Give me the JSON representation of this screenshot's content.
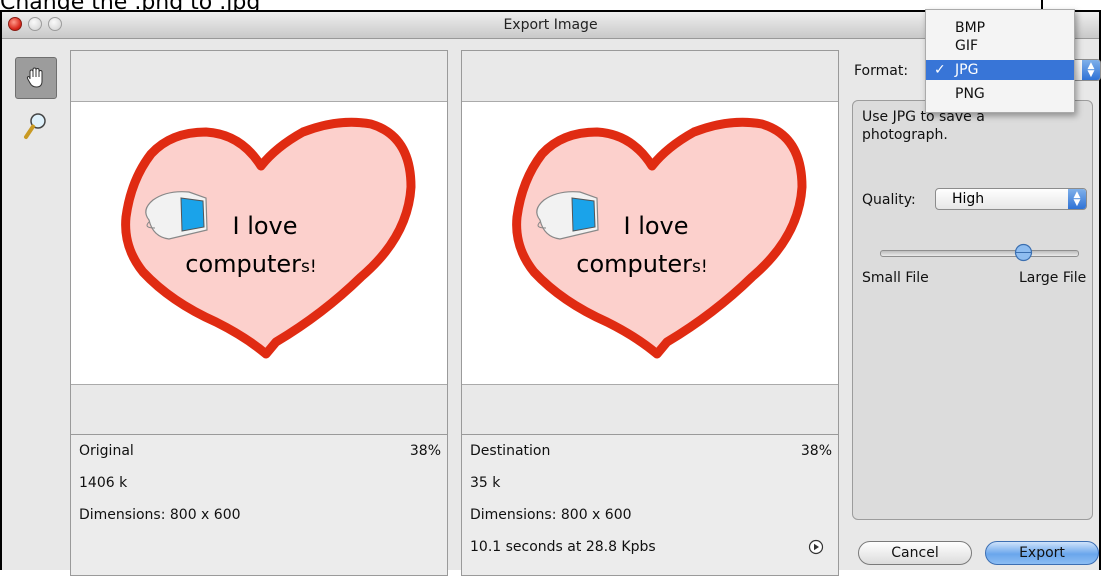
{
  "annotation": {
    "text": "Change the .png to .jpg"
  },
  "window": {
    "title": "Export Image"
  },
  "tools": [
    {
      "icon": "hand-icon"
    },
    {
      "icon": "magnifier-icon"
    }
  ],
  "preview_image": {
    "text_line1": "I love",
    "text_line2": "computer",
    "text_suffix": "s!"
  },
  "original": {
    "label": "Original",
    "zoom": "38%",
    "size": "1406 k",
    "dimensions": "Dimensions: 800 x 600"
  },
  "destination": {
    "label": "Destination",
    "zoom": "38%",
    "size": "35 k",
    "dimensions": "Dimensions: 800 x 600",
    "download_time": "10.1 seconds at 28.8 Kpbs"
  },
  "format": {
    "label": "Format:",
    "options": [
      "BMP",
      "GIF",
      "JPG",
      "PNG"
    ],
    "selected": "JPG",
    "check": "✓",
    "description": "Use JPG to save a photograph."
  },
  "quality": {
    "label": "Quality:",
    "value": "High",
    "slider_level": 0.72,
    "min_label": "Small File",
    "max_label": "Large File"
  },
  "buttons": {
    "cancel": "Cancel",
    "export": "Export"
  },
  "colors": {
    "selection": "#3875d7",
    "heart_outline": "#e02b12",
    "heart_fill": "#fcd0cc",
    "default_button": "#6aa6ec"
  }
}
